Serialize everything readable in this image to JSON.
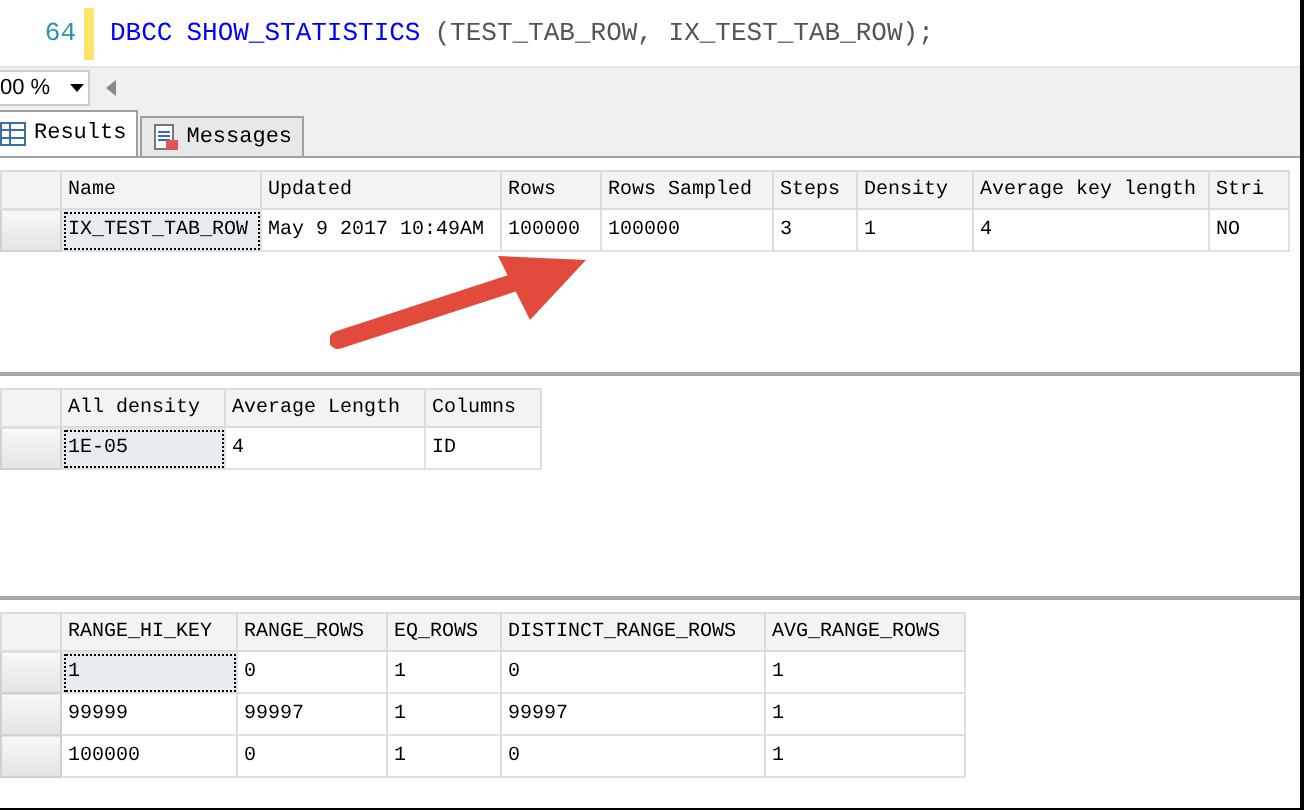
{
  "editor": {
    "line_number": "64",
    "tokens": [
      {
        "text": "DBCC",
        "kind": "keyword"
      },
      {
        "text": "SHOW_STATISTICS",
        "kind": "keyword"
      },
      {
        "text": "(TEST_TAB_ROW, IX_TEST_TAB_ROW);",
        "kind": "plain"
      }
    ]
  },
  "zoom": {
    "value": "00 %"
  },
  "tabs": [
    {
      "label": "Results",
      "selected": true
    },
    {
      "label": "Messages",
      "selected": false
    }
  ],
  "grids": [
    {
      "columns": [
        "Name",
        "Updated",
        "Rows",
        "Rows Sampled",
        "Steps",
        "Density",
        "Average key length",
        "Stri"
      ],
      "rows": [
        {
          "cells": [
            {
              "text": "IX_TEST_TAB_ROW",
              "selected": true
            },
            {
              "text": "May  9 2017 10:49AM",
              "selected": false
            },
            {
              "text": "100000",
              "selected": false
            },
            {
              "text": "100000",
              "selected": false
            },
            {
              "text": "3",
              "selected": false
            },
            {
              "text": "1",
              "selected": false
            },
            {
              "text": "4",
              "selected": false
            },
            {
              "text": "NO",
              "selected": false
            }
          ]
        }
      ]
    },
    {
      "columns": [
        "All density",
        "Average Length",
        "Columns"
      ],
      "rows": [
        {
          "cells": [
            {
              "text": "1E-05",
              "selected": true
            },
            {
              "text": "4",
              "selected": false
            },
            {
              "text": "ID",
              "selected": false
            }
          ]
        }
      ]
    },
    {
      "columns": [
        "RANGE_HI_KEY",
        "RANGE_ROWS",
        "EQ_ROWS",
        "DISTINCT_RANGE_ROWS",
        "AVG_RANGE_ROWS"
      ],
      "rows": [
        {
          "cells": [
            {
              "text": "1",
              "selected": true
            },
            {
              "text": "0",
              "selected": false
            },
            {
              "text": "1",
              "selected": false
            },
            {
              "text": "0",
              "selected": false
            },
            {
              "text": "1",
              "selected": false
            }
          ]
        },
        {
          "cells": [
            {
              "text": "99999",
              "selected": false
            },
            {
              "text": "99997",
              "selected": false
            },
            {
              "text": "1",
              "selected": false
            },
            {
              "text": "99997",
              "selected": false
            },
            {
              "text": "1",
              "selected": false
            }
          ]
        },
        {
          "cells": [
            {
              "text": "100000",
              "selected": false
            },
            {
              "text": "0",
              "selected": false
            },
            {
              "text": "1",
              "selected": false
            },
            {
              "text": "0",
              "selected": false
            },
            {
              "text": "1",
              "selected": false
            }
          ]
        }
      ]
    }
  ]
}
